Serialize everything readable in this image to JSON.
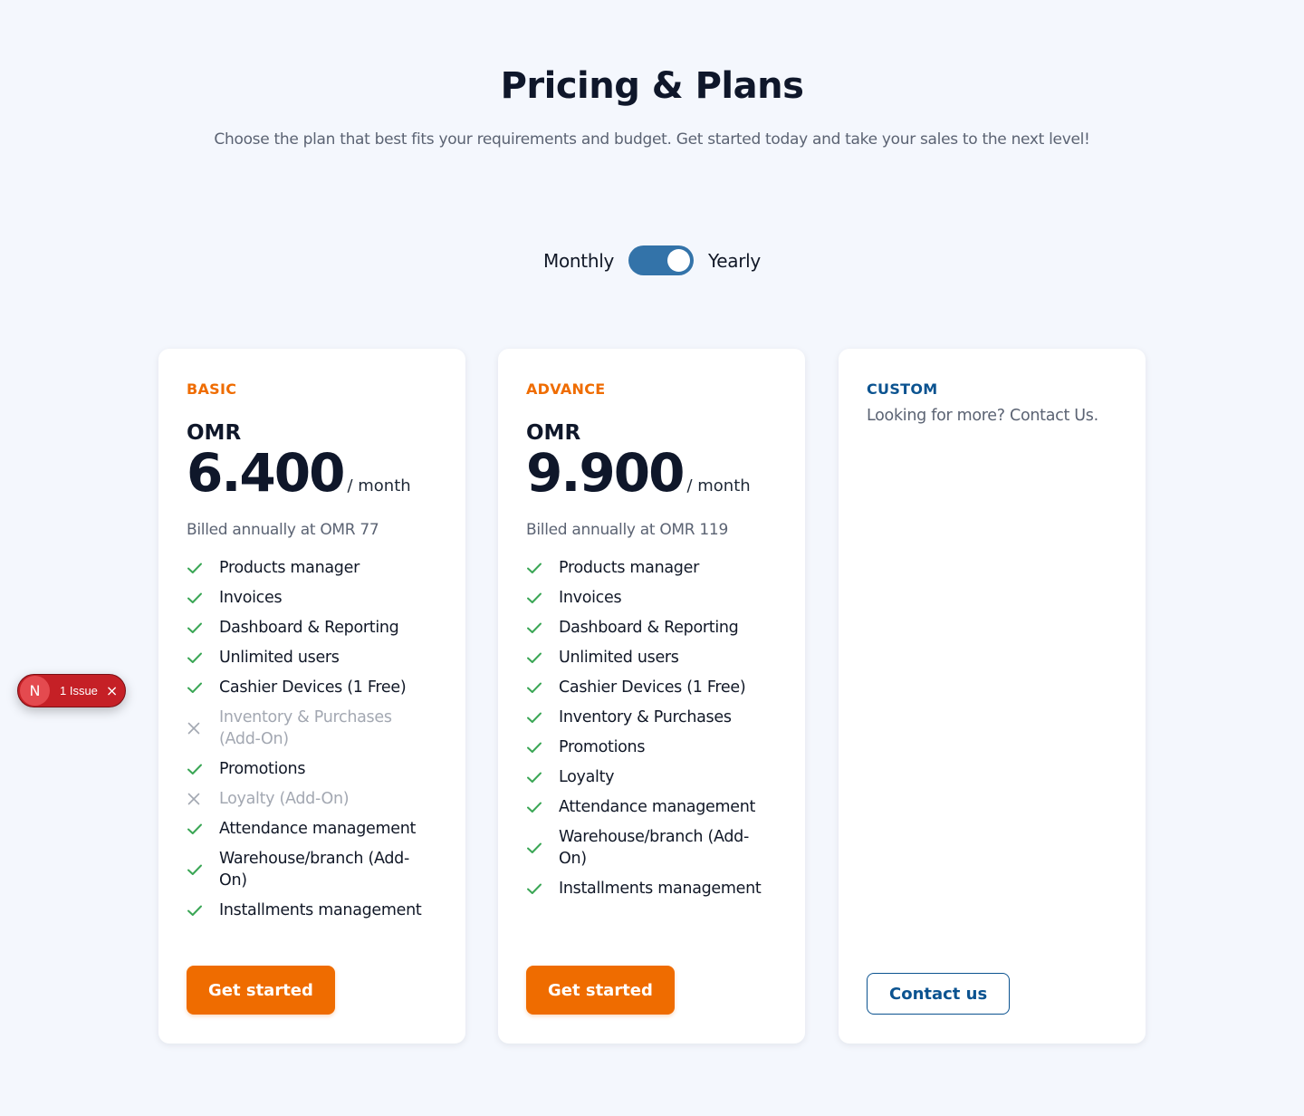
{
  "header": {
    "title": "Pricing & Plans",
    "subtitle": "Choose the plan that best fits your requirements and budget. Get started today and take your sales to the next level!"
  },
  "billing_toggle": {
    "left_label": "Monthly",
    "right_label": "Yearly",
    "selected": "Yearly"
  },
  "plans": [
    {
      "name": "BASIC",
      "currency": "OMR",
      "price": "6.400",
      "period": "/ month",
      "billed": "Billed annually at OMR 77",
      "features": [
        {
          "text": "Products manager",
          "included": true
        },
        {
          "text": "Invoices",
          "included": true
        },
        {
          "text": "Dashboard & Reporting",
          "included": true
        },
        {
          "text": "Unlimited users",
          "included": true
        },
        {
          "text": "Cashier Devices (1 Free)",
          "included": true
        },
        {
          "text": "Inventory & Purchases (Add-On)",
          "included": false
        },
        {
          "text": "Promotions",
          "included": true
        },
        {
          "text": "Loyalty (Add-On)",
          "included": false
        },
        {
          "text": "Attendance management",
          "included": true
        },
        {
          "text": "Warehouse/branch (Add-On)",
          "included": true
        },
        {
          "text": "Installments management",
          "included": true
        }
      ],
      "cta": "Get started"
    },
    {
      "name": "ADVANCE",
      "currency": "OMR",
      "price": "9.900",
      "period": "/ month",
      "billed": "Billed annually at OMR 119",
      "features": [
        {
          "text": "Products manager",
          "included": true
        },
        {
          "text": "Invoices",
          "included": true
        },
        {
          "text": "Dashboard & Reporting",
          "included": true
        },
        {
          "text": "Unlimited users",
          "included": true
        },
        {
          "text": "Cashier Devices (1 Free)",
          "included": true
        },
        {
          "text": "Inventory & Purchases",
          "included": true
        },
        {
          "text": "Promotions",
          "included": true
        },
        {
          "text": "Loyalty",
          "included": true
        },
        {
          "text": "Attendance management",
          "included": true
        },
        {
          "text": "Warehouse/branch (Add-On)",
          "included": true
        },
        {
          "text": "Installments management",
          "included": true
        }
      ],
      "cta": "Get started"
    },
    {
      "name": "CUSTOM",
      "description": "Looking for more? Contact Us.",
      "cta": "Contact us"
    }
  ],
  "issue_badge": {
    "logo_letter": "N",
    "text": "1 Issue",
    "close_glyph": "×"
  },
  "colors": {
    "accent_orange": "#ef6c00",
    "brand_blue": "#0b5390",
    "toggle_blue": "#3373a9",
    "check_green": "#3aa655",
    "cross_gray": "#a3a8b2",
    "page_bg": "#f4f7fd"
  },
  "icons": {
    "included": "check-icon",
    "excluded": "close-icon"
  }
}
